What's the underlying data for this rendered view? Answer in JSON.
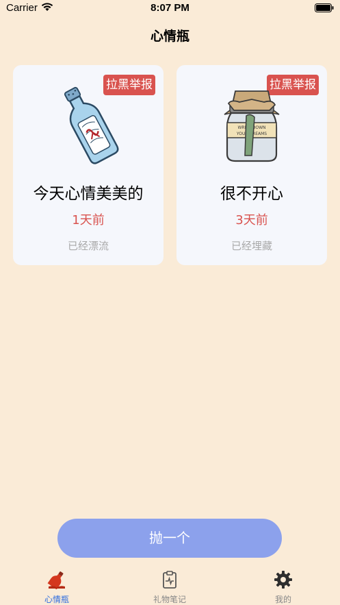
{
  "status_bar": {
    "carrier": "Carrier",
    "time": "8:07 PM"
  },
  "nav": {
    "title": "心情瓶"
  },
  "cards": [
    {
      "report_label": "拉黑举报",
      "title": "今天心情美美的",
      "time": "1天前",
      "status": "已经漂流",
      "image": "message-bottle"
    },
    {
      "report_label": "拉黑举报",
      "title": "很不开心",
      "time": "3天前",
      "status": "已经埋藏",
      "image": "dream-jar"
    }
  ],
  "action": {
    "throw_label": "抛一个"
  },
  "tabs": [
    {
      "label": "心情瓶",
      "icon": "bottle-icon",
      "active": true
    },
    {
      "label": "礼物笔记",
      "icon": "clipboard-icon",
      "active": false
    },
    {
      "label": "我的",
      "icon": "gear-icon",
      "active": false
    }
  ],
  "colors": {
    "background": "#FAEBD7",
    "accent": "#D9534F",
    "button": "#8CA1EC",
    "tab_active": "#2D6CDF"
  }
}
